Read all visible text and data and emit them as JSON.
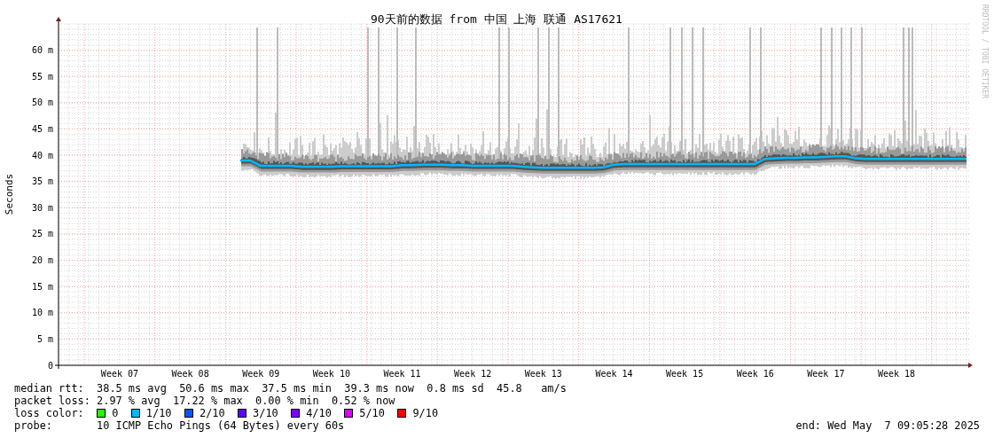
{
  "chart": {
    "credit": "RRDTOOL / TOBI OETIKER",
    "chart_data": {
      "type": "line",
      "title": "90天前的数据 from 中国 上海 联通 AS17621",
      "ylabel": "Seconds",
      "grid": true,
      "categories": [
        null,
        null,
        null,
        null,
        null,
        null,
        "Week 07",
        null,
        null,
        null,
        null,
        null,
        null,
        "Week 08",
        null,
        null,
        null,
        null,
        null,
        null,
        "Week 09",
        null,
        null,
        null,
        null,
        null,
        null,
        "Week 10",
        null,
        null,
        null,
        null,
        null,
        null,
        "Week 11",
        null,
        null,
        null,
        null,
        null,
        null,
        "Week 12",
        null,
        null,
        null,
        null,
        null,
        null,
        "Week 13",
        null,
        null,
        null,
        null,
        null,
        null,
        "Week 14",
        null,
        null,
        null,
        null,
        null,
        null,
        "Week 15",
        null,
        null,
        null,
        null,
        null,
        null,
        "Week 16",
        null,
        null,
        null,
        null,
        null,
        null,
        "Week 17",
        null,
        null,
        null,
        null,
        null,
        null,
        "Week 18",
        null,
        null,
        null,
        null,
        null,
        null,
        null
      ],
      "series": [
        {
          "color": "#00b8ff",
          "values": [
            null,
            null,
            null,
            null,
            null,
            null,
            null,
            null,
            null,
            null,
            null,
            null,
            null,
            null,
            null,
            null,
            null,
            null,
            39,
            39,
            38,
            38,
            38,
            38,
            37.8,
            37.8,
            37.8,
            37.8,
            37.9,
            37.9,
            37.9,
            37.9,
            37.9,
            37.9,
            38.1,
            38.1,
            38.2,
            38.2,
            38.2,
            38.1,
            38.1,
            38,
            38,
            38,
            38,
            38,
            37.8,
            37.7,
            37.6,
            37.6,
            37.6,
            37.6,
            37.6,
            37.6,
            37.7,
            38.2,
            38.3,
            38.3,
            38.3,
            38.3,
            38.3,
            38.3,
            38.3,
            38.3,
            38.3,
            38.3,
            38.3,
            38.3,
            38.3,
            38.3,
            39.3,
            39.4,
            39.5,
            39.5,
            39.6,
            39.6,
            39.7,
            39.8,
            39.8,
            39.4,
            39.3,
            39.3,
            39.3,
            39.3,
            39.3,
            39.3,
            39.3,
            39.3,
            39.3,
            39.3,
            39.3
          ]
        }
      ],
      "ylim": [
        0,
        65
      ],
      "yticks": [
        {
          "value": 0,
          "label": "0"
        },
        {
          "value": 5,
          "label": "5 m"
        },
        {
          "value": 10,
          "label": "10 m"
        },
        {
          "value": 15,
          "label": "15 m"
        },
        {
          "value": 20,
          "label": "20 m"
        },
        {
          "value": 25,
          "label": "25 m"
        },
        {
          "value": 30,
          "label": "30 m"
        },
        {
          "value": 35,
          "label": "35 m"
        },
        {
          "value": 40,
          "label": "40 m"
        },
        {
          "value": 45,
          "label": "45 m"
        },
        {
          "value": 50,
          "label": "50 m"
        },
        {
          "value": 55,
          "label": "55 m"
        },
        {
          "value": 60,
          "label": "60 m"
        }
      ]
    }
  },
  "legend": {
    "median_rtt": {
      "label": "median rtt:",
      "stats": [
        "38.5 ms avg",
        "50.6 ms max",
        "37.5 ms min",
        "39.3 ms now",
        "0.8 ms sd",
        "45.8   am/s"
      ]
    },
    "packet_loss": {
      "label": "packet loss:",
      "stats": [
        "2.97 % avg",
        "17.22 % max",
        "0.00 % min",
        "0.52 % now"
      ]
    },
    "loss_color": {
      "label": "loss color:",
      "items": [
        {
          "label": "0",
          "color": "#26ff00"
        },
        {
          "label": "1/10",
          "color": "#00b8ff"
        },
        {
          "label": "2/10",
          "color": "#0059ff"
        },
        {
          "label": "3/10",
          "color": "#5e00ff"
        },
        {
          "label": "4/10",
          "color": "#7e00ff"
        },
        {
          "label": "5/10",
          "color": "#dd00ff"
        },
        {
          "label": "9/10",
          "color": "#ff0000"
        }
      ]
    },
    "probe": {
      "label": "probe:",
      "text": "10 ICMP Echo Pings (64 Bytes) every 60s"
    },
    "end": "end: Wed May  7 09:05:28 2025"
  }
}
